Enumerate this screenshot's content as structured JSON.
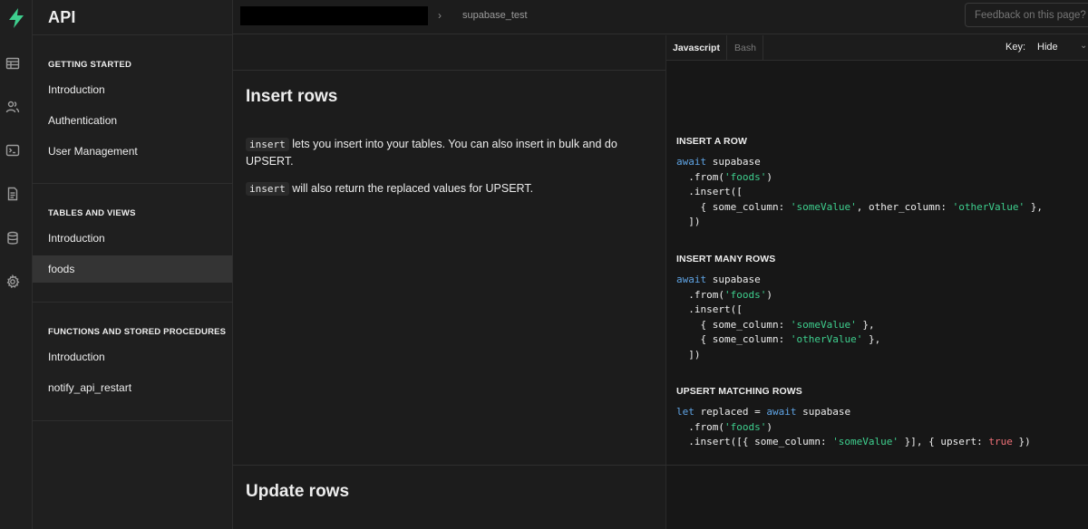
{
  "sidebar": {
    "title": "API",
    "sections": [
      {
        "heading": "GETTING STARTED",
        "items": [
          "Introduction",
          "Authentication",
          "User Management"
        ]
      },
      {
        "heading": "TABLES AND VIEWS",
        "items": [
          "Introduction",
          "foods"
        ]
      },
      {
        "heading": "FUNCTIONS AND STORED PROCEDURES",
        "items": [
          "Introduction",
          "notify_api_restart"
        ]
      }
    ],
    "active_item": "foods"
  },
  "rail_icons": [
    "bolt-logo-icon",
    "table-icon",
    "users-icon",
    "terminal-icon",
    "document-icon",
    "database-icon",
    "gear-icon"
  ],
  "header": {
    "breadcrumb_project": "supabase_test",
    "feedback_placeholder": "Feedback on this page?"
  },
  "lang_tabs": {
    "active": "Javascript",
    "inactive": "Bash"
  },
  "key": {
    "label": "Key:",
    "value": "Hide"
  },
  "insert_section": {
    "title": "Insert rows",
    "p1_code": "insert",
    "p1_text": " lets you insert into your tables. You can also insert in bulk and do UPSERT.",
    "p2_code": "insert",
    "p2_text": " will also return the replaced values for UPSERT.",
    "examples": [
      {
        "title": "INSERT A ROW"
      },
      {
        "title": "INSERT MANY ROWS"
      },
      {
        "title": "UPSERT MATCHING ROWS"
      }
    ]
  },
  "update_section": {
    "title": "Update rows"
  },
  "colors": {
    "brand": "#3ecf8e",
    "keyword": "#5fa4e5",
    "string": "#3ecf8e",
    "boolean": "#f07178"
  }
}
